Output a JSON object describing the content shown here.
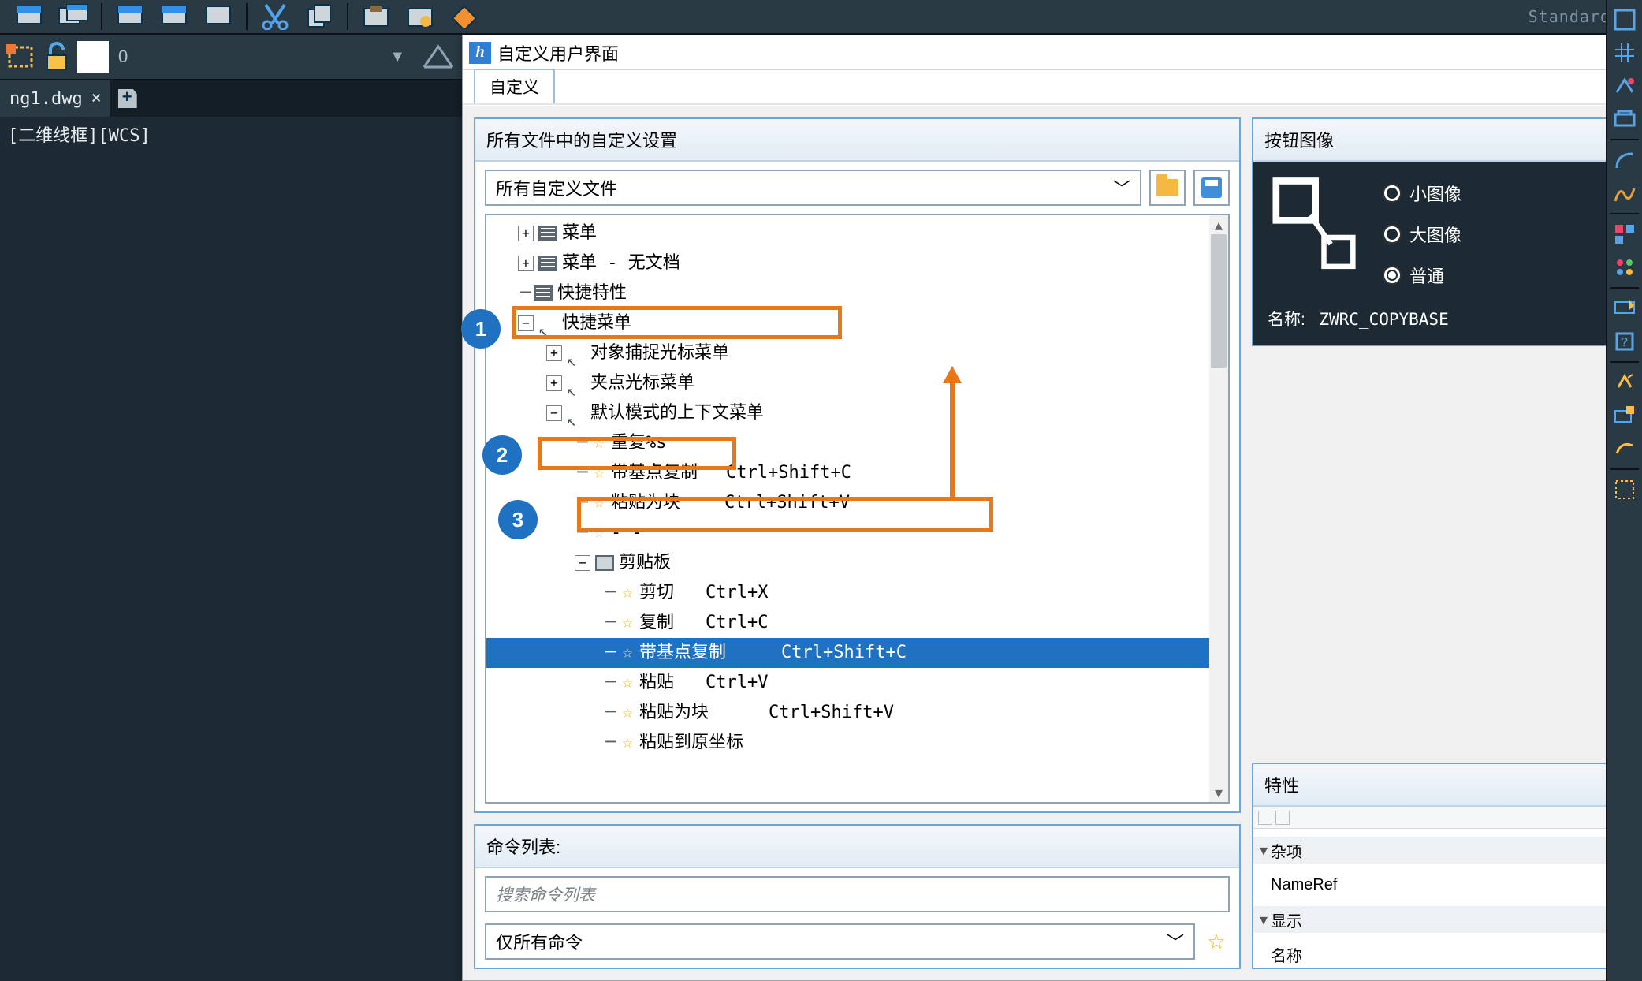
{
  "toolbar": {
    "standard_label": "Standard"
  },
  "layer_strip": {
    "zero": "0"
  },
  "doc_tab": {
    "name": "ng1.dwg"
  },
  "viewport_label": "[二维线框][WCS]",
  "cui": {
    "title": "自定义用户界面",
    "tab": "自定义",
    "left": {
      "settings_header": "所有文件中的自定义设置",
      "file_selector": "所有自定义文件",
      "tree": {
        "menu": "菜单",
        "menu_nodoc": "菜单 - 无文档",
        "quick_props": "快捷特性",
        "shortcut_menu": "快捷菜单",
        "snap_menu": "对象捕捉光标菜单",
        "grip_menu": "夹点光标菜单",
        "default_ctx": "默认模式的上下文菜单",
        "repeat": "重复%s",
        "copybase1": "带基点复制",
        "copybase1_sc": "Ctrl+Shift+C",
        "pasteblock1": "粘贴为块",
        "pasteblock1_sc": "Ctrl+Shift+V",
        "sep": "- -",
        "clipboard": "剪贴板",
        "cut": "剪切",
        "cut_sc": "Ctrl+X",
        "copy": "复制",
        "copy_sc": "Ctrl+C",
        "copybase2": "带基点复制",
        "copybase2_sc": "Ctrl+Shift+C",
        "paste": "粘贴",
        "paste_sc": "Ctrl+V",
        "pasteblock2": "粘贴为块",
        "pasteblock2_sc": "Ctrl+Shift+V",
        "paste_orig": "粘贴到原坐标"
      },
      "cmdlist_header": "命令列表:",
      "search_placeholder": "搜索命令列表",
      "cmd_selector": "仅所有命令"
    },
    "right": {
      "btnimg_header": "按钮图像",
      "small": "小图像",
      "large": "大图像",
      "normal": "普通",
      "name_label": "名称:",
      "name_value": "ZWRC_COPYBASE",
      "props_header": "特性",
      "misc": "杂项",
      "nameref": "NameRef",
      "display": "显示",
      "name": "名称"
    }
  },
  "callouts": {
    "n1": "1",
    "n2": "2",
    "n3": "3"
  }
}
